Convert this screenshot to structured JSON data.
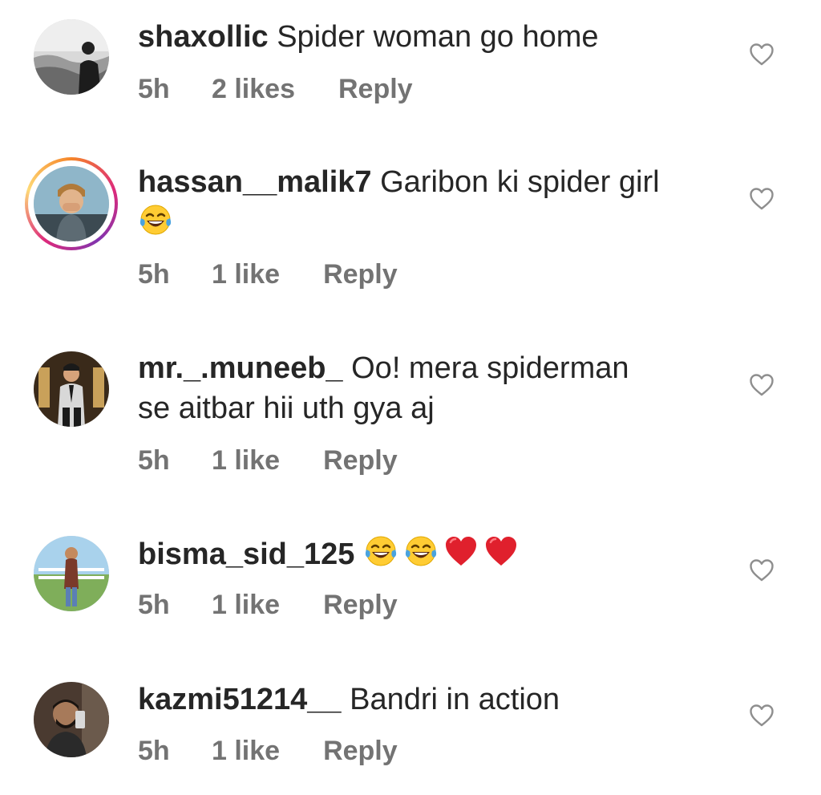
{
  "comments": [
    {
      "username": "shaxollic",
      "text": "Spider woman go home",
      "time": "5h",
      "likes": "2 likes",
      "reply": "Reply",
      "avatar_icon": "avatar-beach-photo",
      "has_story": false
    },
    {
      "username": "hassan__malik7",
      "text": "Garibon ki spider girl",
      "emojis": [
        "face-with-tears-of-joy"
      ],
      "time": "5h",
      "likes": "1 like",
      "reply": "Reply",
      "avatar_icon": "avatar-selfie-photo",
      "has_story": true
    },
    {
      "username": "mr._.muneeb_",
      "text": "Oo!  mera spiderman",
      "text_line2": "se aitbar hii uth gya aj",
      "time": "5h",
      "likes": "1 like",
      "reply": "Reply",
      "avatar_icon": "avatar-suit-photo",
      "has_story": false
    },
    {
      "username": "bisma_sid_125",
      "text": "",
      "emojis": [
        "face-with-tears-of-joy",
        "face-with-tears-of-joy",
        "red-heart",
        "red-heart"
      ],
      "time": "5h",
      "likes": "1 like",
      "reply": "Reply",
      "avatar_icon": "avatar-park-photo",
      "has_story": false
    },
    {
      "username": "kazmi51214__",
      "text": "Bandri in action",
      "time": "5h",
      "likes": "1 like",
      "reply": "Reply",
      "avatar_icon": "avatar-mirror-selfie-photo",
      "has_story": false
    }
  ],
  "icons": {
    "like": "heart-outline-icon"
  },
  "colors": {
    "text": "#262626",
    "meta": "#737373",
    "heart_outline": "#8e8e8e",
    "heart_red": "#e0202d",
    "emoji_yellow": "#ffcc33",
    "emoji_tears": "#4aa3df"
  }
}
